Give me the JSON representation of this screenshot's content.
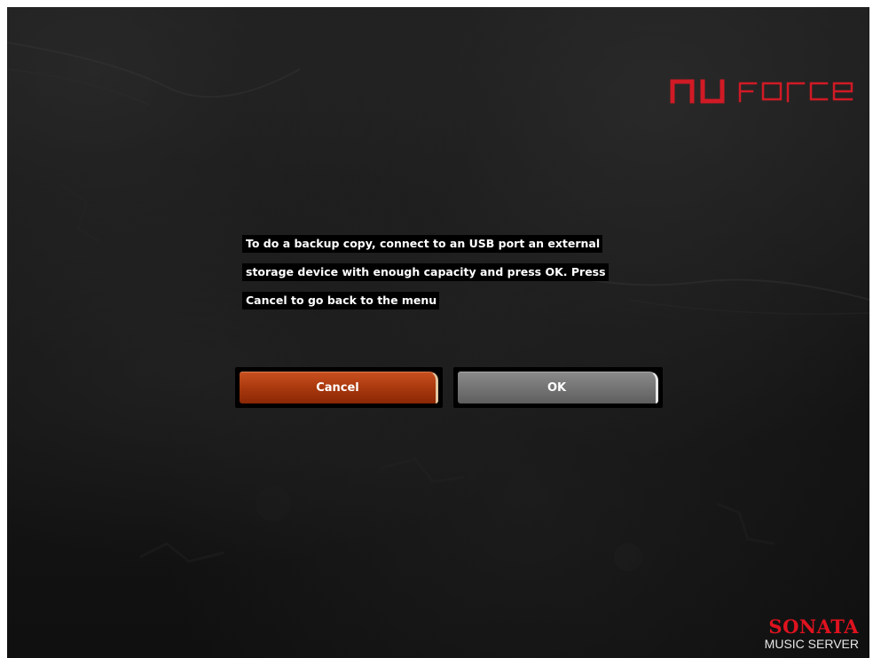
{
  "brand": {
    "logo_text": "nu force",
    "logo_color": "#d01a25"
  },
  "message": {
    "lines": [
      "To do a backup copy, connect to an USB port an external",
      "storage device with enough capacity and press OK. Press",
      "Cancel to go back to the menu"
    ]
  },
  "buttons": {
    "cancel_label": "Cancel",
    "ok_label": "OK",
    "cancel_color": "#b0400f",
    "ok_color": "#7a7a7a"
  },
  "product": {
    "name": "SONATA",
    "subtitle": "MUSIC SERVER",
    "name_color": "#e0121f"
  }
}
